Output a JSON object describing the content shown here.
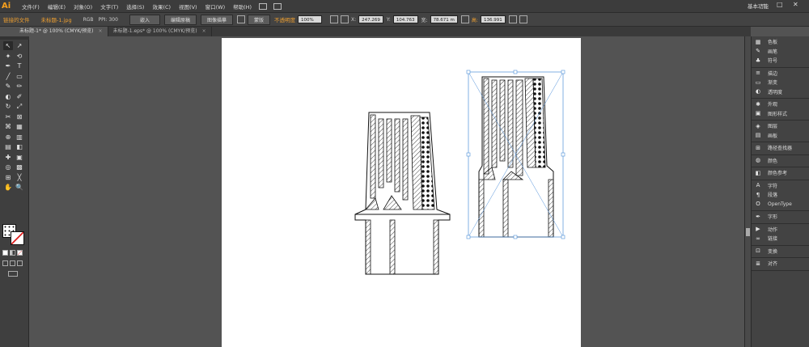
{
  "menubar": {
    "logo": "Ai",
    "items": [
      "文件(F)",
      "编辑(E)",
      "对象(O)",
      "文字(T)",
      "选择(S)",
      "效果(C)",
      "视图(V)",
      "窗口(W)",
      "帮助(H)"
    ],
    "workspace": "基本功能",
    "window_buttons": [
      "—",
      "□",
      "✕"
    ]
  },
  "options_bar": {
    "linked_file": "链接的文件",
    "filename": "未标题-1.jpg",
    "color_mode": "RGB",
    "ppi": "PPI: 300",
    "embed_button": "嵌入",
    "edit_original_button": "编辑原稿",
    "image_trace_button": "图像描摹",
    "mask_button": "蒙版",
    "opacity_label": "不透明度",
    "opacity_value": "100%",
    "x_label": "X:",
    "x_value": "247.269",
    "y_label": "Y:",
    "y_value": "104.763",
    "w_label": "宽:",
    "w_value": "78.671 m",
    "h_label": "高:",
    "h_value": "136.991"
  },
  "tabs": [
    {
      "label": "未标题-1* @ 100% (CMYK/预览)",
      "close": "×"
    },
    {
      "label": "未标题-1.eps* @ 100% (CMYK/预览)",
      "close": "×"
    }
  ],
  "tools": [
    "↖",
    "↗",
    "✦",
    "⟲",
    "✒",
    "T",
    "╱",
    "▭",
    "✎",
    "✏",
    "◐",
    "✐",
    "↻",
    "⤢",
    "✂",
    "⊠",
    "⌘",
    "▦",
    "⊕",
    "▥",
    "▤",
    "◧",
    "✚",
    "▣",
    "◎",
    "▩",
    "⊞",
    "╳",
    "✋",
    "🔍"
  ],
  "panels": [
    {
      "group": [
        {
          "icon": "▦",
          "label": "色板"
        },
        {
          "icon": "✎",
          "label": "画笔"
        },
        {
          "icon": "♣",
          "label": "符号"
        }
      ]
    },
    {
      "group": [
        {
          "icon": "≡",
          "label": "描边"
        },
        {
          "icon": "▭",
          "label": "渐变"
        },
        {
          "icon": "◐",
          "label": "透明度"
        }
      ]
    },
    {
      "group": [
        {
          "icon": "✱",
          "label": "外观"
        },
        {
          "icon": "▣",
          "label": "图形样式"
        }
      ]
    },
    {
      "group": [
        {
          "icon": "◈",
          "label": "图层"
        },
        {
          "icon": "▤",
          "label": "画板"
        }
      ]
    },
    {
      "group": [
        {
          "icon": "⊞",
          "label": "路径查找器"
        }
      ]
    },
    {
      "group": [
        {
          "icon": "◍",
          "label": "颜色"
        }
      ]
    },
    {
      "group": [
        {
          "icon": "◧",
          "label": "颜色参考"
        }
      ]
    },
    {
      "group": [
        {
          "icon": "A",
          "label": "字符"
        },
        {
          "icon": "¶",
          "label": "段落"
        },
        {
          "icon": "O",
          "label": "OpenType"
        }
      ]
    },
    {
      "group": [
        {
          "icon": "✒",
          "label": "字形"
        }
      ]
    },
    {
      "group": [
        {
          "icon": "▶",
          "label": "动作"
        },
        {
          "icon": "∞",
          "label": "链接"
        }
      ]
    },
    {
      "group": [
        {
          "icon": "⊡",
          "label": "变换"
        }
      ]
    },
    {
      "group": [
        {
          "icon": "≣",
          "label": "对齐"
        }
      ]
    }
  ]
}
